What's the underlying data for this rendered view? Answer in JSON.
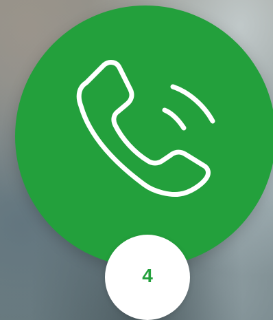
{
  "step": {
    "number": "4",
    "icon": "phone-calling-icon"
  },
  "colors": {
    "accent": "#23a03c",
    "badge_background": "#ffffff",
    "icon_stroke": "#ffffff"
  }
}
